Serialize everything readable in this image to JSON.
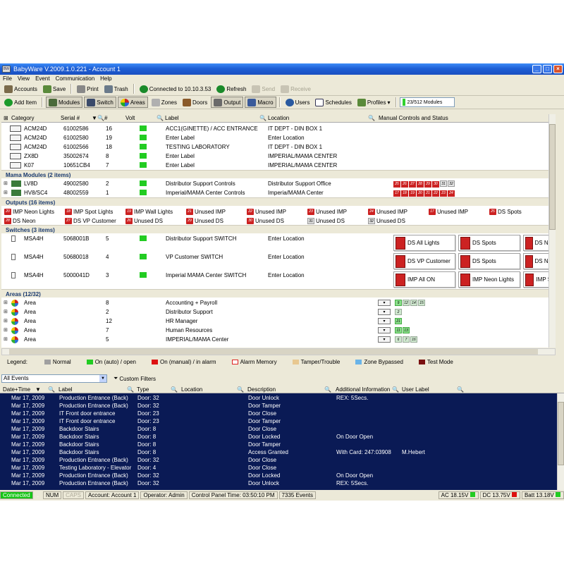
{
  "title": "BabyWare V.2009.1.0.221 - Account 1",
  "menu": [
    "File",
    "View",
    "Event",
    "Communication",
    "Help"
  ],
  "toolbar1": {
    "accounts": "Accounts",
    "save": "Save",
    "print": "Print",
    "trash": "Trash",
    "connected": "Connected to 10.10.3.53",
    "refresh": "Refresh",
    "send": "Send",
    "receive": "Receive"
  },
  "toolbar2": {
    "add_item": "Add Item",
    "modules": "Modules",
    "switch": "Switch",
    "areas": "Areas",
    "zones": "Zones",
    "doors": "Doors",
    "output": "Output",
    "macro": "Macro",
    "users": "Users",
    "schedules": "Schedules",
    "profiles": "Profiles",
    "modules_count": "23/512 Modules"
  },
  "grid_headers": {
    "category": "Category",
    "serial": "Serial #",
    "num": "#",
    "volt": "Volt",
    "label": "Label",
    "location": "Location",
    "controls": "Manual Controls and Status"
  },
  "modules_rows": [
    {
      "cat": "ACM24D",
      "serial": "61002586",
      "num": "16",
      "label": "ACC1(GINETTE) / ACC ENTRANCE",
      "location": "IT DEPT - DIN BOX 1"
    },
    {
      "cat": "ACM24D",
      "serial": "61002580",
      "num": "19",
      "label": "Enter Label",
      "location": "Enter Location"
    },
    {
      "cat": "ACM24D",
      "serial": "61002566",
      "num": "18",
      "label": "TESTING LABORATORY",
      "location": "IT DEPT - DIN BOX 1"
    },
    {
      "cat": "ZX8D",
      "serial": "35002674",
      "num": "8",
      "label": "Enter Label",
      "location": "IMPERIAL/MAMA CENTER"
    },
    {
      "cat": "K07",
      "serial": "10651CB4",
      "num": "7",
      "label": "Enter Label",
      "location": "IMPERIAL/MAMA CENTER"
    }
  ],
  "mama_group": "Mama Modules (2 items)",
  "mama_rows": [
    {
      "cat": "LV8D",
      "serial": "49002580",
      "num": "2",
      "label": "Distributor Support Controls",
      "location": "Distributor Support Office",
      "squares": [
        "25",
        "26",
        "27",
        "28",
        "29",
        "30",
        "31",
        "32"
      ]
    },
    {
      "cat": "HV8/SC4",
      "serial": "48002559",
      "num": "1",
      "label": "Imperial/MAMA Center Controls",
      "location": "Imperia/MAMA Center",
      "squares": [
        "17",
        "18",
        "19",
        "20",
        "21",
        "22",
        "23",
        "24"
      ]
    }
  ],
  "outputs_group": "Outputs (16 items)",
  "outputs_row1": [
    {
      "n": "20",
      "t": "IMP Neon Lights"
    },
    {
      "n": "18",
      "t": "IMP Spot Lights"
    },
    {
      "n": "19",
      "t": "IMP Wall Lights"
    },
    {
      "n": "21",
      "t": "Unused IMP"
    },
    {
      "n": "22",
      "t": "Unused IMP"
    },
    {
      "n": "23",
      "t": "Unused IMP"
    },
    {
      "n": "24",
      "t": "Unused IMP"
    },
    {
      "n": "17",
      "t": "Unused IMP"
    },
    {
      "n": "25",
      "t": "DS Spots"
    }
  ],
  "outputs_row2": [
    {
      "n": "28",
      "t": "DS Neon"
    },
    {
      "n": "27",
      "t": "DS VP Customer"
    },
    {
      "n": "26",
      "t": "Unused DS"
    },
    {
      "n": "29",
      "t": "Unused DS"
    },
    {
      "n": "30",
      "t": "Unused DS"
    },
    {
      "n": "31",
      "t": "Unused DS"
    },
    {
      "n": "32",
      "t": "Unused DS"
    }
  ],
  "switches_group": "Switches (3 items)",
  "switch_rows": [
    {
      "cat": "MSA4H",
      "serial": "5068001B",
      "num": "5",
      "label": "Distributor Support SWITCH",
      "location": "Enter Location",
      "btns": [
        "DS All Lights",
        "DS Spots",
        "DS Neon"
      ]
    },
    {
      "cat": "MSA4H",
      "serial": "50680018",
      "num": "4",
      "label": "VP Customer SWITCH",
      "location": "Enter Location",
      "btns": [
        "DS VP Customer",
        "DS Spots",
        "DS Neon"
      ]
    },
    {
      "cat": "MSA4H",
      "serial": "5000041D",
      "num": "3",
      "label": "Imperial MAMA Center SWITCH",
      "location": "Enter Location",
      "btns": [
        "IMP All ON",
        "IMP Neon Lights",
        "IMP Spo"
      ]
    }
  ],
  "areas_group": "Areas (12/32)",
  "area_rows": [
    {
      "cat": "Area",
      "num": "8",
      "label": "Accounting + Payroll",
      "sq": [
        "9",
        "12",
        "14",
        "15"
      ]
    },
    {
      "cat": "Area",
      "num": "2",
      "label": "Distributor Support",
      "sq": [
        "2"
      ]
    },
    {
      "cat": "Area",
      "num": "12",
      "label": "HR Manager",
      "sq": [
        "21"
      ]
    },
    {
      "cat": "Area",
      "num": "7",
      "label": "Human Resources",
      "sq": [
        "11",
        "13"
      ]
    },
    {
      "cat": "Area",
      "num": "5",
      "label": "IMPERIAL/MAMA Center",
      "sq": [
        "6",
        "7",
        "16"
      ]
    }
  ],
  "legend": {
    "title": "Legend:",
    "items": [
      {
        "t": "Normal",
        "c": "#a0a0a0"
      },
      {
        "t": "On (auto) / open",
        "c": "#22cc22"
      },
      {
        "t": "On (manual) / in alarm",
        "c": "#dd1111"
      },
      {
        "t": "Alarm Memory",
        "c": "#ffffff"
      },
      {
        "t": "Tamper/Trouble",
        "c": "#e8c890"
      },
      {
        "t": "Zone Bypassed",
        "c": "#6ab4e8"
      },
      {
        "t": "Test Mode",
        "c": "#7a1010"
      }
    ]
  },
  "filter": {
    "all_events": "All Events",
    "custom": "Custom Filters"
  },
  "event_headers": {
    "date": "Date+Time",
    "label": "Label",
    "type": "Type",
    "location": "Location",
    "description": "Description",
    "additional": "Additional Information",
    "user": "User Label"
  },
  "events": [
    {
      "d": "Mar 17, 2009",
      "l": "Production Entrance (Back)",
      "t": "Door: 32",
      "desc": "Door Unlock",
      "add": "REX: 5Secs.",
      "u": ""
    },
    {
      "d": "Mar 17, 2009",
      "l": "Production Entrance (Back)",
      "t": "Door: 32",
      "desc": "Door Tamper",
      "add": "",
      "u": ""
    },
    {
      "d": "Mar 17, 2009",
      "l": "IT Front door entrance",
      "t": "Door: 23",
      "desc": "Door Close",
      "add": "",
      "u": ""
    },
    {
      "d": "Mar 17, 2009",
      "l": "IT Front door entrance",
      "t": "Door: 23",
      "desc": "Door Tamper",
      "add": "",
      "u": ""
    },
    {
      "d": "Mar 17, 2009",
      "l": "Backdoor Stairs",
      "t": "Door: 8",
      "desc": "Door Close",
      "add": "",
      "u": ""
    },
    {
      "d": "Mar 17, 2009",
      "l": "Backdoor Stairs",
      "t": "Door: 8",
      "desc": "Door Locked",
      "add": "On Door Open",
      "u": ""
    },
    {
      "d": "Mar 17, 2009",
      "l": "Backdoor Stairs",
      "t": "Door: 8",
      "desc": "Door Tamper",
      "add": "",
      "u": ""
    },
    {
      "d": "Mar 17, 2009",
      "l": "Backdoor Stairs",
      "t": "Door: 8",
      "desc": "Access Granted",
      "add": "With Card: 247:03908",
      "u": "M.Hebert"
    },
    {
      "d": "Mar 17, 2009",
      "l": "Production Entrance (Back)",
      "t": "Door: 32",
      "desc": "Door Close",
      "add": "",
      "u": ""
    },
    {
      "d": "Mar 17, 2009",
      "l": "Testing Laboratory - Elevator",
      "t": "Door: 4",
      "desc": "Door Close",
      "add": "",
      "u": ""
    },
    {
      "d": "Mar 17, 2009",
      "l": "Production Entrance (Back)",
      "t": "Door: 32",
      "desc": "Door Locked",
      "add": "On Door Open",
      "u": ""
    },
    {
      "d": "Mar 17, 2009",
      "l": "Production Entrance (Back)",
      "t": "Door: 32",
      "desc": "Door Unlock",
      "add": "REX: 5Secs.",
      "u": ""
    }
  ],
  "status": {
    "connected": "Connected",
    "num": "NUM",
    "caps": "CAPS",
    "account": "Account: Account 1",
    "operator": "Operator: Admin",
    "time": "Control Panel Time: 03:50:10 PM",
    "events": "7335 Events",
    "ac": "AC 18.15V",
    "dc": "DC 13.75V",
    "batt": "Batt 13.18V"
  }
}
